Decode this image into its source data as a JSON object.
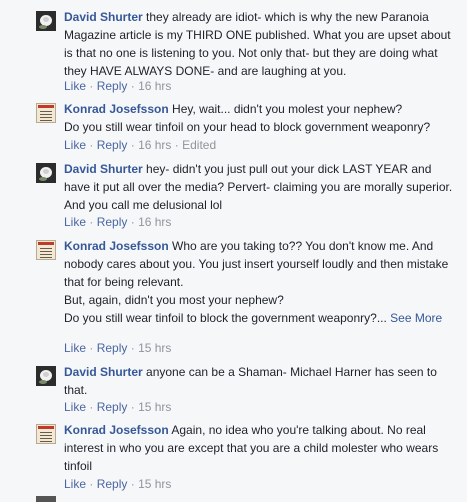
{
  "actions": {
    "like": "Like",
    "reply": "Reply",
    "separator": "·",
    "edited": "Edited",
    "see_more": "See More"
  },
  "comments": [
    {
      "author": "David Shurter",
      "avatar_icon": "white-rose-avatar-icon",
      "text": "they already are idiot- which is why the new Paranoia Magazine article is my THIRD ONE published. What you are upset about is that no one is listening to you. Not only that- but they are doing what they HAVE ALWAYS DONE- and are laughing at you.",
      "time": "16 hrs"
    },
    {
      "author": "Konrad Josefsson",
      "avatar_icon": "notice-poster-avatar-icon",
      "text": "Hey, wait... didn't you molest your nephew?\nDo you still wear tinfoil on your head to block government weaponry?",
      "time": "16 hrs",
      "edited": true
    },
    {
      "author": "David Shurter",
      "avatar_icon": "white-rose-avatar-icon",
      "text": "hey- didn't you just pull out your dick LAST YEAR and have it put all over the media? Pervert- claiming you are morally superior. And you call me delusional lol",
      "time": "16 hrs"
    },
    {
      "author": "Konrad Josefsson",
      "avatar_icon": "notice-poster-avatar-icon",
      "text": "Who are you taking to?? You don't know me. And nobody cares about you. You just insert yourself loudly and then mistake that for being relevant.\nBut, again, didn't you most your nephew?\nDo you still wear tinfoil to block the government weaponry?...",
      "time": "15 hrs",
      "truncated": true
    },
    {
      "author": "David Shurter",
      "avatar_icon": "white-rose-avatar-icon",
      "text": "anyone can be a Shaman- Michael Harner has seen to that.",
      "time": "15 hrs"
    },
    {
      "author": "Konrad Josefsson",
      "avatar_icon": "notice-poster-avatar-icon",
      "text": "Again, no idea who you're talking about. No real interest in who you are except that you are a child molester who wears tinfoil",
      "time": "15 hrs"
    }
  ]
}
